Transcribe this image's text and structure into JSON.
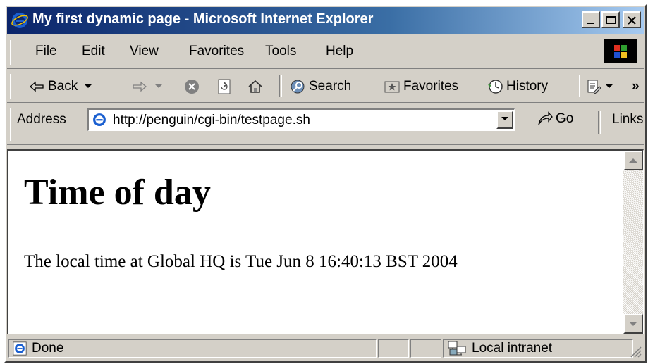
{
  "window": {
    "title": "My first dynamic page - Microsoft Internet Explorer"
  },
  "menu": [
    "File",
    "Edit",
    "View",
    "Favorites",
    "Tools",
    "Help"
  ],
  "toolbar": {
    "back_label": "Back",
    "search_label": "Search",
    "favorites_label": "Favorites",
    "history_label": "History",
    "more_label": "»"
  },
  "address": {
    "label": "Address",
    "url": "http://penguin/cgi-bin/testpage.sh",
    "go_label": "Go",
    "links_label": "Links"
  },
  "page": {
    "heading": "Time of day",
    "text": "The local time at Global HQ is Tue Jun 8 16:40:13 BST 2004"
  },
  "status": {
    "text": "Done",
    "zone": "Local intranet"
  },
  "colors": {
    "title_bar_start": "#0a246a",
    "title_bar_end": "#a6caf0",
    "chrome": "#d4d0c8"
  }
}
